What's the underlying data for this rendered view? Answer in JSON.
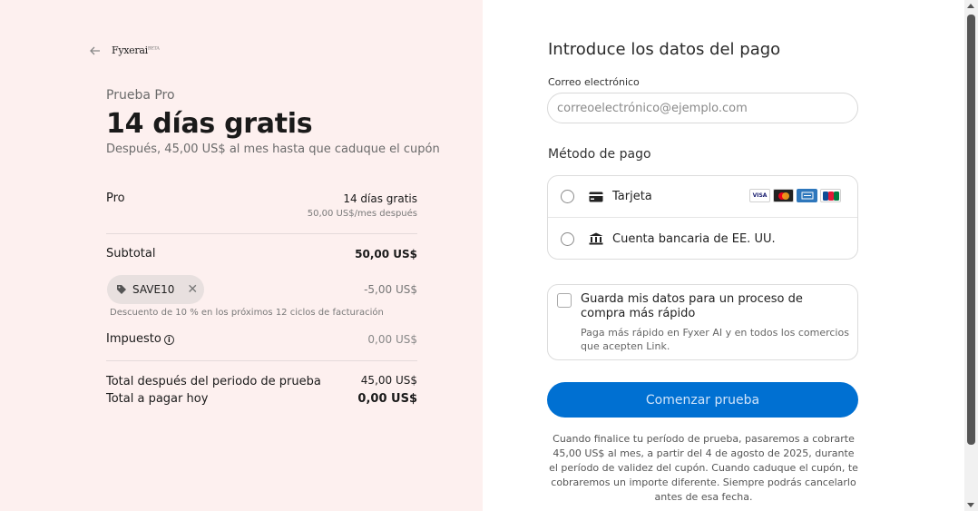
{
  "header": {
    "brand": "Fyxer",
    "brand_suffix": "ai",
    "brand_mark": "BETA"
  },
  "summary": {
    "plan_label": "Prueba Pro",
    "headline": "14 días gratis",
    "subtitle": "Después, 45,00 US$ al mes hasta que caduque el cupón",
    "line_item": {
      "label": "Pro",
      "value": "14 días gratis",
      "note": "50,00 US$/mes después"
    },
    "subtotal": {
      "label": "Subtotal",
      "value": "50,00 US$"
    },
    "coupon": {
      "code": "SAVE10",
      "discount": "-5,00 US$",
      "description": "Descuento de 10 % en los próximos 12 ciclos de facturación"
    },
    "tax": {
      "label": "Impuesto",
      "value": "0,00 US$"
    },
    "total_after_trial": {
      "label": "Total después del periodo de prueba",
      "value": "45,00 US$"
    },
    "total_today": {
      "label": "Total a pagar hoy",
      "value": "0,00 US$"
    }
  },
  "payment": {
    "title": "Introduce los datos del pago",
    "email_label": "Correo electrónico",
    "email_placeholder": "correoelectrónico@ejemplo.com",
    "email_value": "",
    "method_label": "Método de pago",
    "methods": [
      {
        "label": "Tarjeta",
        "icon": "card-icon"
      },
      {
        "label": "Cuenta bancaria de EE. UU.",
        "icon": "bank-icon"
      }
    ],
    "card_brands": [
      "VISA",
      "MC",
      "AMEX",
      "JCB"
    ],
    "save_title": "Guarda mis datos para un proceso de compra más rápido",
    "save_desc": "Paga más rápido en Fyxer AI y en todos los comercios que acepten Link.",
    "cta": "Comenzar prueba",
    "legal": "Cuando finalice tu período de prueba, pasaremos a cobrarte 45,00 US$ al mes, a partir del 4 de agosto de 2025, durante el período de validez del cupón. Cuando caduque el cupón, te cobraremos un importe diferente. Siempre podrás cancelarlo antes de esa fecha."
  },
  "colors": {
    "left_bg": "#fdf0ef",
    "accent": "#0070d2",
    "coupon_bg": "#e8e0df"
  }
}
